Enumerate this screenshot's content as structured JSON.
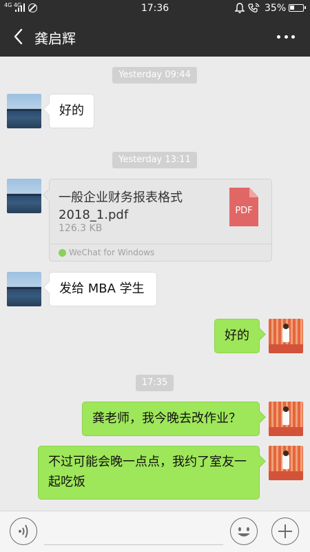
{
  "status_bar": {
    "network": "4G 4G",
    "time": "17:36",
    "battery": "35%",
    "icons": [
      "signal-icon",
      "no-sim-icon",
      "alarm-bell-icon",
      "wifi-call-icon",
      "battery-icon"
    ]
  },
  "header": {
    "title": "龚启辉",
    "back_icon": "back-arrow-icon",
    "more_icon": "more-icon"
  },
  "timestamps": [
    "Yesterday 09:44",
    "Yesterday 13:11",
    "17:35"
  ],
  "messages": [
    {
      "side": "left",
      "text": "好的"
    },
    {
      "side": "left",
      "type": "file",
      "file_name": "一般企业财务报表格式2018_1.pdf",
      "file_size": "126.3 KB",
      "file_type": "PDF",
      "source": "WeChat for Windows"
    },
    {
      "side": "left",
      "text": "发给 MBA 学生"
    },
    {
      "side": "right",
      "text": "好的"
    },
    {
      "side": "right",
      "text": "龚老师，我今晚去改作业？"
    },
    {
      "side": "right",
      "text": "不过可能会晚一点点，我约了室友一起吃饭"
    }
  ],
  "input_bar": {
    "voice_icon": "voice-icon",
    "emoji_icon": "emoji-icon",
    "plus_icon": "plus-icon"
  },
  "colors": {
    "header_bg": "#2e2e2e",
    "chat_bg": "#ebebeb",
    "self_bubble": "#9fe75a",
    "other_bubble": "#ffffff",
    "pdf_icon": "#e06766"
  }
}
